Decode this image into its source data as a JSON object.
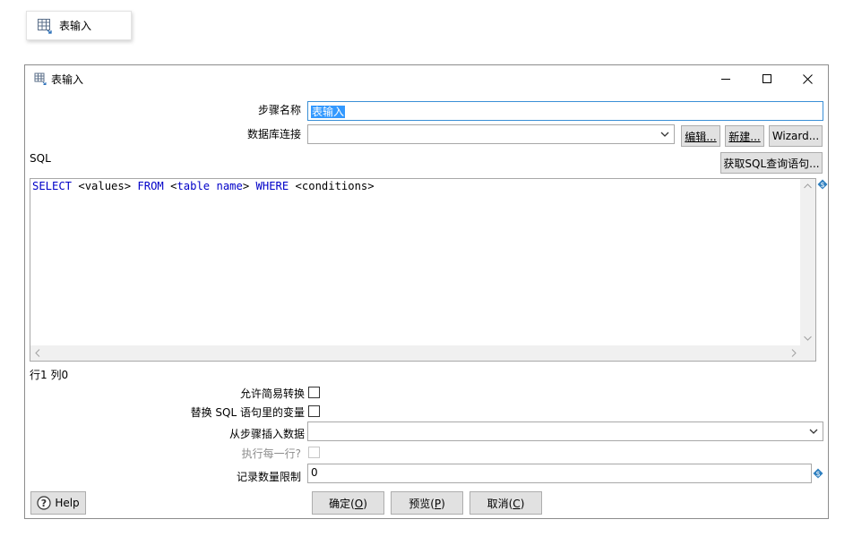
{
  "node": {
    "label": "表输入"
  },
  "dialog": {
    "title": "表输入",
    "step_name": {
      "label": "步骤名称",
      "value": "表输入"
    },
    "db_connection": {
      "label": "数据库连接",
      "value": "",
      "edit_label": "编辑...",
      "new_label": "新建...",
      "wizard_label": "Wizard..."
    },
    "sql": {
      "label": "SQL",
      "get_query_label": "获取SQL查询语句...",
      "tokens": [
        {
          "text": "SELECT",
          "kw": true
        },
        {
          "text": " <values> ",
          "kw": false
        },
        {
          "text": "FROM",
          "kw": true
        },
        {
          "text": " <",
          "kw": false
        },
        {
          "text": "table",
          "kw": true
        },
        {
          "text": " ",
          "kw": false
        },
        {
          "text": "name",
          "kw": true
        },
        {
          "text": "> ",
          "kw": false
        },
        {
          "text": "WHERE",
          "kw": true
        },
        {
          "text": " <conditions>",
          "kw": false
        }
      ]
    },
    "status": {
      "row_col": "行1 列0"
    },
    "options": {
      "lazy_conversion": {
        "label": "允许简易转换",
        "checked": false
      },
      "replace_variables": {
        "label": "替换 SQL 语句里的变量",
        "checked": false
      },
      "insert_from_step": {
        "label": "从步骤插入数据",
        "value": ""
      },
      "execute_each_row": {
        "label": "执行每一行?",
        "checked": false,
        "enabled": false
      },
      "limit": {
        "label": "记录数量限制",
        "value": "0"
      }
    },
    "buttons": {
      "help": "Help",
      "ok_text": "确定(",
      "ok_key": "O",
      "preview_text": "预览(",
      "preview_key": "P",
      "cancel_text": "取消(",
      "cancel_key": "C",
      "close_paren": ")"
    }
  }
}
